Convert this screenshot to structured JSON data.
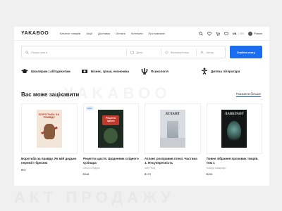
{
  "header": {
    "logo": "YAKABOO",
    "nav": [
      "Каталог товарів",
      "Акції",
      "Доставка",
      "Оплата",
      "Контакти",
      "Про магазин"
    ],
    "lang_active": "UA",
    "lang_inactive": "EN",
    "user_name": "Роман"
  },
  "search": {
    "title_placeholder": "Пошук книги",
    "date_placeholder": "Дата",
    "age_placeholder": "Вік/жанр/тема",
    "note_placeholder": "Автор",
    "button_label": "Знайти книгу"
  },
  "categories": [
    {
      "label": "Школярам | абітурієнтам",
      "icon": "graduation-cap-icon"
    },
    {
      "label": "Бізнес, гроші, економіка",
      "icon": "money-icon"
    },
    {
      "label": "Психологія",
      "icon": "psi-icon"
    },
    {
      "label": "Дитяча література",
      "icon": "children-icon"
    }
  ],
  "watermark": "YAKABOO",
  "watermark2": "АКТ ПРОДАЖУ",
  "section": {
    "title": "Вас може зацікавити",
    "show_more": "Показати більше"
  },
  "books": [
    {
      "title": "Боротьба за правду. Як мій дедько перемігт брехню",
      "author": "",
      "price": "₴92",
      "badge": "",
      "cover_text": "БОРОТЬБА ЗА ПРАВДУ"
    },
    {
      "title": "Рецепти щастя. Щоденник східного кулінара",
      "author": "Ольга Стадник",
      "price": "₴348",
      "badge": "NEW",
      "cover_text": "Рецепти щастя"
    },
    {
      "title": "Атлант розправив плечі. Частина 1. Несуперечність",
      "author": "Айн Ренд",
      "price": "₴170",
      "badge": "",
      "cover_text": "АТЛАНТ"
    },
    {
      "title": "Повне зібрання прозових творів. Том 1",
      "author": "Говард Лавкрафт",
      "price": "₴295",
      "badge": "",
      "cover_text": "ЛАВКРАФТ"
    }
  ]
}
